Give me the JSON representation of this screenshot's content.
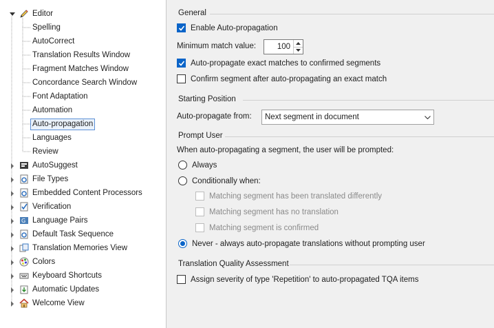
{
  "tree": {
    "editor_label": "Editor",
    "editor_children": [
      "Spelling",
      "AutoCorrect",
      "Translation Results Window",
      "Fragment Matches Window",
      "Concordance Search Window",
      "Font Adaptation",
      "Automation",
      "Auto-propagation",
      "Languages",
      "Review"
    ],
    "selected": "Auto-propagation",
    "top_items": [
      {
        "label": "AutoSuggest",
        "icon": "autosuggest-icon"
      },
      {
        "label": "File Types",
        "icon": "gear-doc-icon"
      },
      {
        "label": "Embedded Content Processors",
        "icon": "gear-doc-icon"
      },
      {
        "label": "Verification",
        "icon": "verification-icon"
      },
      {
        "label": "Language Pairs",
        "icon": "language-pairs-icon"
      },
      {
        "label": "Default Task Sequence",
        "icon": "gear-doc-icon"
      },
      {
        "label": "Translation Memories View",
        "icon": "translation-memory-icon"
      },
      {
        "label": "Colors",
        "icon": "colors-icon"
      },
      {
        "label": "Keyboard Shortcuts",
        "icon": "keyboard-icon"
      },
      {
        "label": "Automatic Updates",
        "icon": "updates-icon"
      },
      {
        "label": "Welcome View",
        "icon": "home-icon"
      }
    ]
  },
  "general": {
    "title": "General",
    "enable_label": "Enable Auto-propagation",
    "enable_checked": true,
    "min_match_label": "Minimum match value:",
    "min_match_value": "100",
    "exact_label": "Auto-propagate exact matches to confirmed segments",
    "exact_checked": true,
    "confirm_label": "Confirm segment after auto-propagating an exact match",
    "confirm_checked": false
  },
  "starting": {
    "title": "Starting Position",
    "from_label": "Auto-propagate from:",
    "from_value": "Next segment in document"
  },
  "prompt": {
    "title": "Prompt User",
    "intro": "When auto-propagating a segment, the user will be prompted:",
    "always_label": "Always",
    "conditional_label": "Conditionally when:",
    "cond_translated_diff": "Matching segment has been translated differently",
    "cond_no_translation": "Matching segment has no translation",
    "cond_confirmed": "Matching segment is confirmed",
    "never_label": "Never - always auto-propagate translations without prompting user",
    "selected": "never"
  },
  "tqa": {
    "title": "Translation Quality Assessment",
    "assign_label": "Assign severity of type 'Repetition' to auto-propagated TQA items",
    "assign_checked": false
  },
  "colors": {
    "accent": "#0a64c8",
    "selection_border": "#5a8fd6"
  }
}
